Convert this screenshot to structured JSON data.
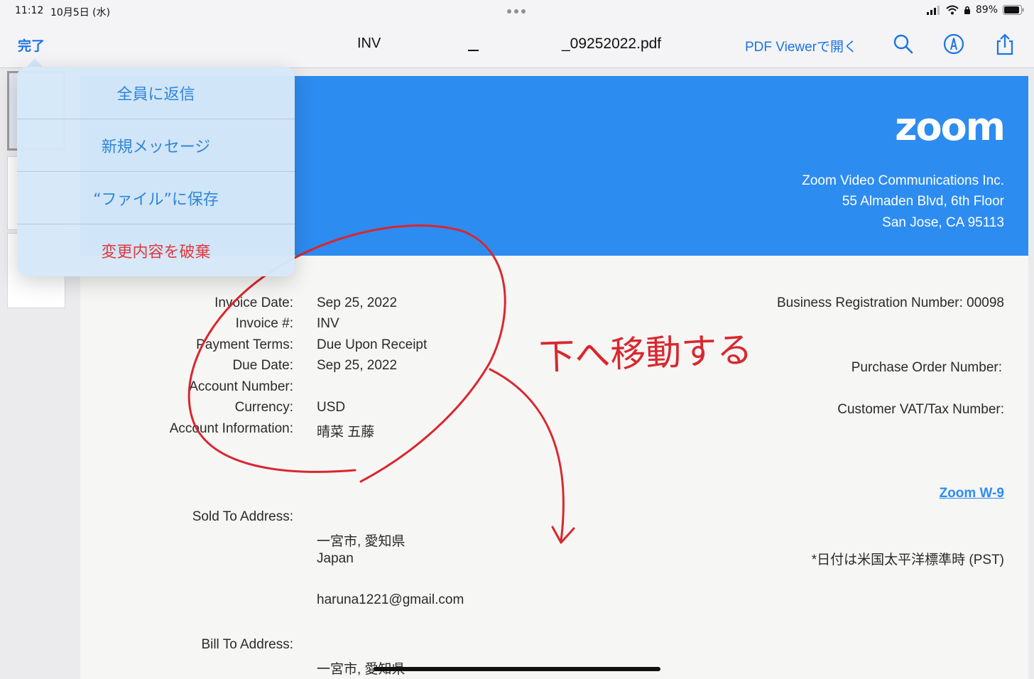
{
  "status_bar": {
    "time": "11:12",
    "date": "10月5日 (水)",
    "battery": "89%"
  },
  "toolbar": {
    "done_label": "完了",
    "title_part1": "INV",
    "title_part2": "_09252022.pdf",
    "open_in_label": "PDF Viewerで開く",
    "icons": [
      "search-icon",
      "markup-icon",
      "share-icon"
    ]
  },
  "menu": {
    "items": [
      {
        "label": "全員に返信",
        "style": "normal"
      },
      {
        "label": "新規メッセージ",
        "style": "normal"
      },
      {
        "label": "“ファイル”に保存",
        "style": "normal"
      },
      {
        "label": "変更内容を破棄",
        "style": "destructive"
      }
    ]
  },
  "document": {
    "brand": "zoom",
    "company": {
      "name": "Zoom Video Communications Inc.",
      "street": "55 Almaden Blvd, 6th Floor",
      "city": "San Jose, CA 95113"
    },
    "fields": [
      {
        "label": "Invoice Date:",
        "value": "Sep 25, 2022"
      },
      {
        "label": "Invoice #:",
        "value": "INV"
      },
      {
        "label": "Payment Terms:",
        "value": "Due Upon Receipt"
      },
      {
        "label": "Due Date:",
        "value": "Sep 25, 2022"
      },
      {
        "label": "Account Number:",
        "value": ""
      },
      {
        "label": "Currency:",
        "value": "USD"
      },
      {
        "label": "Account Information:",
        "value": "晴菜 五藤"
      }
    ],
    "right": {
      "business_reg": "Business Registration Number: 00098",
      "po_number": "Purchase Order Number:",
      "vat": "Customer VAT/Tax Number:",
      "w9_link": "Zoom W-9",
      "pst_note": "*日付は米国太平洋標準時 (PST)"
    },
    "sold_to": {
      "label": "Sold To Address:",
      "city": "一宮市, 愛知県",
      "country": "Japan",
      "email": "haruna1221@gmail.com"
    },
    "bill_to": {
      "label": "Bill To Address:",
      "city": "一宮市, 愛知県"
    }
  },
  "annotation": {
    "handwritten_text": "下へ移動する",
    "color": "#d9272e"
  },
  "colors": {
    "accent": "#1a73e8",
    "banner": "#2d8cf0",
    "destructive": "#e0393e"
  }
}
